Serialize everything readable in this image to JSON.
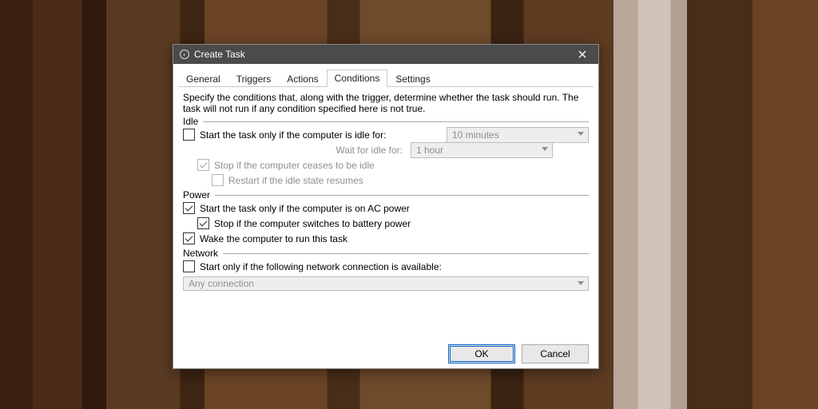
{
  "window": {
    "title": "Create Task"
  },
  "tabs": {
    "general": "General",
    "triggers": "Triggers",
    "actions": "Actions",
    "conditions": "Conditions",
    "settings": "Settings"
  },
  "description": "Specify the conditions that, along with the trigger, determine whether the task should run.  The task will not run  if any condition specified here is not true.",
  "idle": {
    "legend": "Idle",
    "start_if_idle_label": "Start the task only if the computer is idle for:",
    "idle_duration_value": "10 minutes",
    "wait_for_idle_label": "Wait for idle for:",
    "wait_for_idle_value": "1 hour",
    "stop_if_not_idle_label": "Stop if the computer ceases to be idle",
    "restart_if_idle_label": "Restart if the idle state resumes"
  },
  "power": {
    "legend": "Power",
    "ac_power_label": "Start the task only if the computer is on AC power",
    "stop_on_battery_label": "Stop if the computer switches to battery power",
    "wake_label": "Wake the computer to run this task"
  },
  "network": {
    "legend": "Network",
    "start_if_network_label": "Start only if the following network connection is available:",
    "connection_value": "Any connection"
  },
  "buttons": {
    "ok": "OK",
    "cancel": "Cancel"
  }
}
